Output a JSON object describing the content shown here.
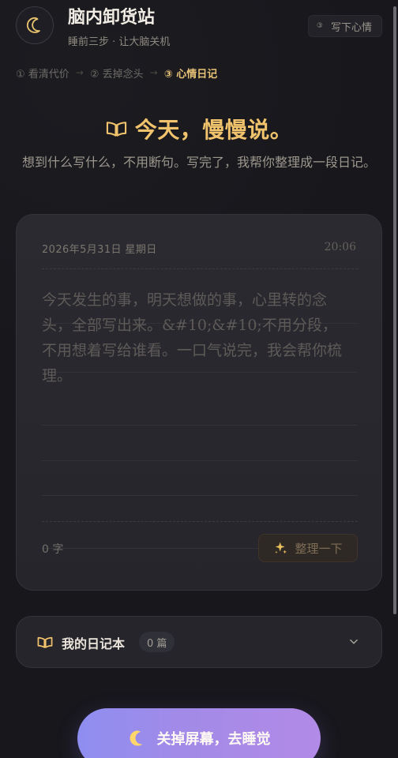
{
  "header": {
    "title": "脑内卸货站",
    "subtitle": "睡前三步 · 让大脑关机",
    "step_pill": {
      "number": "③",
      "label": "写下心情"
    }
  },
  "steps": [
    "① 看清代价",
    "② 丢掉念头",
    "③ 心情日记"
  ],
  "hero": {
    "title": "今天，慢慢说。",
    "description": "想到什么写什么，不用断句。写完了，我帮你整理成一段日记。"
  },
  "journal": {
    "date": "2026年5月31日  星期日",
    "time": "20:06",
    "placeholder": "今天发生的事，明天想做的事，心里转的念头，全部写出来。&#10;&#10;不用分段，不用想着写给谁看。一口气说完，我会帮你梳理。",
    "char_count": "0 字",
    "tidy_label": "整理一下"
  },
  "notebook": {
    "title": "我的日记本",
    "count": "0 篇"
  },
  "sleep_button": {
    "label": "关掉屏幕，去睡觉"
  },
  "colors": {
    "background": "#17171c",
    "accent": "#f0c36c",
    "journal_card": "#2b2a31",
    "button_gradient_start": "#8e8ef0",
    "button_gradient_end": "#b28ae7"
  },
  "icons": {
    "logo": "moon-icon",
    "book": "book-open-icon",
    "sparkle": "sparkle-icon",
    "chevron": "chevron-down-icon",
    "sleep": "crescent-moon-icon"
  }
}
